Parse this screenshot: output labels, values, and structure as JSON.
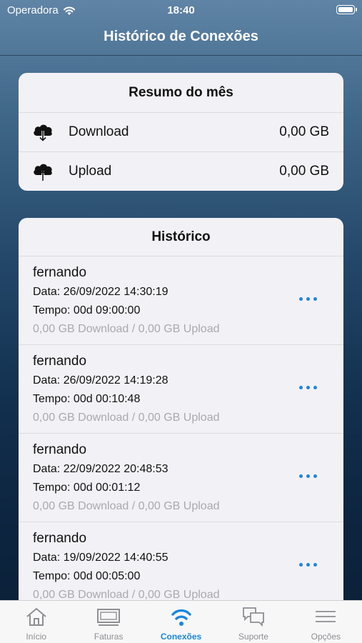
{
  "status": {
    "carrier": "Operadora",
    "time": "18:40"
  },
  "nav": {
    "title": "Histórico de Conexões"
  },
  "summary": {
    "title": "Resumo do mês",
    "rows": [
      {
        "icon": "cloud-download-icon",
        "label": "Download",
        "value": "0,00 GB"
      },
      {
        "icon": "cloud-upload-icon",
        "label": "Upload",
        "value": "0,00 GB"
      }
    ]
  },
  "history": {
    "title": "Histórico",
    "items": [
      {
        "name": "fernando",
        "date": "Data: 26/09/2022 14:30:19",
        "duration": "Tempo: 00d 09:00:00",
        "usage": "0,00 GB Download / 0,00 GB Upload"
      },
      {
        "name": "fernando",
        "date": "Data: 26/09/2022 14:19:28",
        "duration": "Tempo: 00d 00:10:48",
        "usage": "0,00 GB Download / 0,00 GB Upload"
      },
      {
        "name": "fernando",
        "date": "Data: 22/09/2022 20:48:53",
        "duration": "Tempo: 00d 00:01:12",
        "usage": "0,00 GB Download / 0,00 GB Upload"
      },
      {
        "name": "fernando",
        "date": "Data: 19/09/2022 14:40:55",
        "duration": "Tempo: 00d 00:05:00",
        "usage": "0,00 GB Download / 0,00 GB Upload"
      }
    ]
  },
  "tabs": [
    {
      "label": "Início",
      "icon": "home-icon"
    },
    {
      "label": "Faturas",
      "icon": "invoice-icon"
    },
    {
      "label": "Conexões",
      "icon": "wifi-icon",
      "active": true
    },
    {
      "label": "Suporte",
      "icon": "chat-icon"
    },
    {
      "label": "Opções",
      "icon": "menu-icon"
    }
  ],
  "colors": {
    "accent": "#1a86e0",
    "card": "#f2f2f6",
    "muted": "#a9a9ae"
  }
}
